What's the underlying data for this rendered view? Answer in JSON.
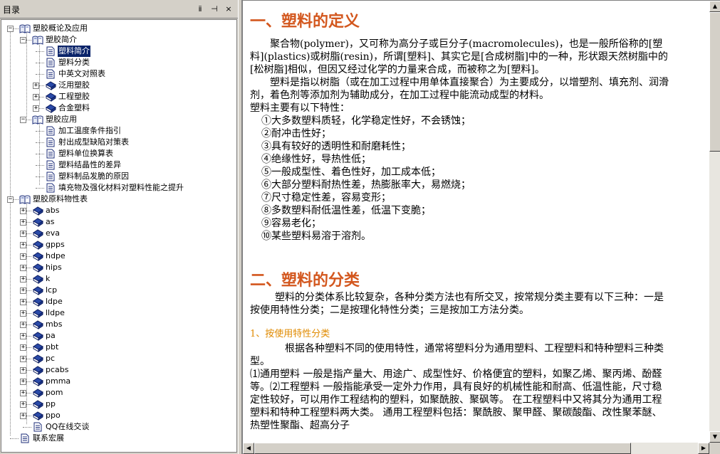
{
  "pane": {
    "title": "目录",
    "buttons": [
      "ⅱ",
      "⊣",
      "×"
    ]
  },
  "tree": [
    {
      "depth": 0,
      "type": "book-open",
      "label": "塑胶概论及应用",
      "expander": "−"
    },
    {
      "depth": 1,
      "type": "book-open",
      "label": "塑胶简介",
      "expander": "−"
    },
    {
      "depth": 2,
      "type": "page",
      "label": "塑料简介",
      "selected": true
    },
    {
      "depth": 2,
      "type": "page",
      "label": "塑料分类"
    },
    {
      "depth": 2,
      "type": "page",
      "label": "中英文对照表"
    },
    {
      "depth": 2,
      "type": "book",
      "label": "泛用塑胶",
      "expander": "+"
    },
    {
      "depth": 2,
      "type": "book",
      "label": "工程塑胶",
      "expander": "+"
    },
    {
      "depth": 2,
      "type": "book",
      "label": "合金塑料",
      "expander": "+"
    },
    {
      "depth": 1,
      "type": "book-open",
      "label": "塑胶应用",
      "expander": "−"
    },
    {
      "depth": 2,
      "type": "page",
      "label": "加工温度条件指引"
    },
    {
      "depth": 2,
      "type": "page",
      "label": "射出成型缺陷对策表"
    },
    {
      "depth": 2,
      "type": "page",
      "label": "塑料单位换算表"
    },
    {
      "depth": 2,
      "type": "page",
      "label": "塑料结晶性的差异"
    },
    {
      "depth": 2,
      "type": "page",
      "label": "塑料制品发脆的原因"
    },
    {
      "depth": 2,
      "type": "page",
      "label": "填充物及强化材料对塑料性能之提升"
    },
    {
      "depth": 0,
      "type": "book-open",
      "label": "塑胶原料物性表",
      "expander": "−"
    },
    {
      "depth": 1,
      "type": "book",
      "label": "abs",
      "expander": "+"
    },
    {
      "depth": 1,
      "type": "book",
      "label": "as",
      "expander": "+"
    },
    {
      "depth": 1,
      "type": "book",
      "label": "eva",
      "expander": "+"
    },
    {
      "depth": 1,
      "type": "book",
      "label": "gpps",
      "expander": "+"
    },
    {
      "depth": 1,
      "type": "book",
      "label": "hdpe",
      "expander": "+"
    },
    {
      "depth": 1,
      "type": "book",
      "label": "hips",
      "expander": "+"
    },
    {
      "depth": 1,
      "type": "book",
      "label": "k",
      "expander": "+"
    },
    {
      "depth": 1,
      "type": "book",
      "label": "lcp",
      "expander": "+"
    },
    {
      "depth": 1,
      "type": "book",
      "label": "ldpe",
      "expander": "+"
    },
    {
      "depth": 1,
      "type": "book",
      "label": "lldpe",
      "expander": "+"
    },
    {
      "depth": 1,
      "type": "book",
      "label": "mbs",
      "expander": "+"
    },
    {
      "depth": 1,
      "type": "book",
      "label": "pa",
      "expander": "+"
    },
    {
      "depth": 1,
      "type": "book",
      "label": "pbt",
      "expander": "+"
    },
    {
      "depth": 1,
      "type": "book",
      "label": "pc",
      "expander": "+"
    },
    {
      "depth": 1,
      "type": "book",
      "label": "pcabs",
      "expander": "+"
    },
    {
      "depth": 1,
      "type": "book",
      "label": "pmma",
      "expander": "+"
    },
    {
      "depth": 1,
      "type": "book",
      "label": "pom",
      "expander": "+"
    },
    {
      "depth": 1,
      "type": "book",
      "label": "pp",
      "expander": "+"
    },
    {
      "depth": 1,
      "type": "book",
      "label": "ppo",
      "expander": "+"
    },
    {
      "depth": 1,
      "type": "page",
      "label": "QQ在线交谈"
    },
    {
      "depth": 0,
      "type": "page",
      "label": "联系宏展"
    }
  ],
  "article": {
    "section1_title": "一、塑料的定义",
    "section1_p1": "聚合物(polymer)，又可称为高分子或巨分子(macromolecules)，也是一般所俗称的[塑料](plastics)或树脂(resin)，所谓[塑料]、其实它是[合成树脂]中的一种，形状跟天然树脂中的[松树脂]相似，但因又经过化学的力量来合成，而被称之为[塑料]。",
    "section1_p2": "塑料是指以树脂（或在加工过程中用单体直接聚合）为主要成分，以增塑剂、填充剂、润滑剂，着色剂等添加剂为辅助成分，在加工过程中能流动成型的材料。",
    "section1_p3": "塑料主要有以下特性：",
    "features": [
      "①大多数塑料质轻，化学稳定性好，不会锈蚀；",
      "②耐冲击性好；",
      "③具有较好的透明性和耐磨耗性；",
      "④绝缘性好，导热性低；",
      "⑤一般成型性、着色性好，加工成本低；",
      "⑥大部分塑料耐热性差，热膨胀率大，易燃烧；",
      "⑦尺寸稳定性差，容易变形；",
      "⑧多数塑料耐低温性差，低温下变脆；",
      "⑨容易老化；",
      "⑩某些塑料易溶于溶剂。"
    ],
    "section2_title": "二、塑料的分类",
    "section2_p1": "塑料的分类体系比较复杂，各种分类方法也有所交叉，按常规分类主要有以下三种：一是按使用特性分类；二是按理化特性分类；三是按加工方法分类。",
    "sub1_title": "1、按使用特性分类",
    "sub1_p1": "根据各种塑料不同的使用特性，通常将塑料分为通用塑料、工程塑料和特种塑料三种类型。",
    "sub1_p2": "⑴通用塑料  一般是指产量大、用途广、成型性好、价格便宜的塑料，如聚乙烯、聚丙烯、酚醛等。⑵工程塑料  一般指能承受一定外力作用，具有良好的机械性能和耐高、低温性能，尺寸稳定性较好，可以用作工程结构的塑料，如聚酰胺、聚砜等。        在工程塑料中又将其分为通用工程塑料和特种工程塑料两大类。        通用工程塑料包括：聚酰胺、聚甲醛、聚碳酸酯、改性聚苯醚、热塑性聚酯、超高分子"
  },
  "colors": {
    "heading": "#d3571e",
    "subheading": "#e08a00",
    "selection": "#0a246a"
  },
  "scrollbar": {
    "vertical_position": 0.0,
    "horizontal_position": 0.0
  }
}
